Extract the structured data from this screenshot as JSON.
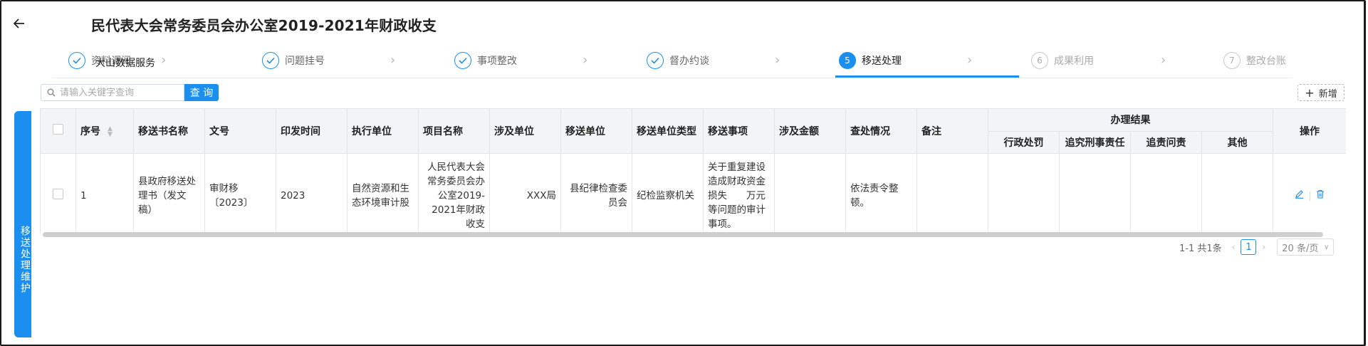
{
  "header": {
    "title": "民代表大会常务委员会办公室2019-2021年财政收支",
    "overlay_label": "大山数据服务"
  },
  "steps": [
    {
      "num": "1",
      "label": "资料调阅",
      "state": "done"
    },
    {
      "num": "2",
      "label": "问题挂号",
      "state": "done"
    },
    {
      "num": "3",
      "label": "事项整改",
      "state": "done"
    },
    {
      "num": "4",
      "label": "督办约谈",
      "state": "done"
    },
    {
      "num": "5",
      "label": "移送处理",
      "state": "active"
    },
    {
      "num": "6",
      "label": "成果利用",
      "state": "pending"
    },
    {
      "num": "7",
      "label": "整改台账",
      "state": "pending"
    }
  ],
  "side_tab": {
    "label": "移送处理维护"
  },
  "search": {
    "placeholder": "请输入关键字查询",
    "button_label": "查 询"
  },
  "add_button": {
    "label": "新增"
  },
  "table": {
    "headers": {
      "index": "序号",
      "doc_name": "移送书名称",
      "doc_no": "文号",
      "issue_time": "印发时间",
      "exec_unit": "执行单位",
      "project": "项目名称",
      "involved_unit": "涉及单位",
      "transfer_unit": "移送单位",
      "transfer_unit_type": "移送单位类型",
      "transfer_item": "移送事项",
      "amount": "涉及金额",
      "handling": "查处情况",
      "remark": "备注",
      "result_group": "办理结果",
      "admin_penalty": "行政处罚",
      "criminal": "追究刑事责任",
      "accountability": "追责问责",
      "other": "其他",
      "ops": "操作"
    },
    "rows": [
      {
        "index": "1",
        "doc_name": "县政府移送处理书（发文稿）",
        "doc_no": "审财移〔2023〕",
        "issue_time": "2023",
        "exec_unit": "自然资源和生态环境审计股",
        "project": "人民代表大会常务委员会办公室2019-2021年财政收支",
        "involved_unit": "XXX局",
        "transfer_unit": "县纪律检查委员会",
        "transfer_unit_type": "纪检监察机关",
        "transfer_item": "关于重复建设造成财政资金损失　　万元等问题的审计事项。",
        "amount": "",
        "handling": "依法责令整顿。",
        "remark": "",
        "admin_penalty": "",
        "criminal": "",
        "accountability": "",
        "other": ""
      }
    ]
  },
  "pagination": {
    "summary": "1-1 共1条",
    "current_page": "1",
    "page_size": "20 条/页"
  },
  "colors": {
    "accent": "#1a8ff0"
  }
}
